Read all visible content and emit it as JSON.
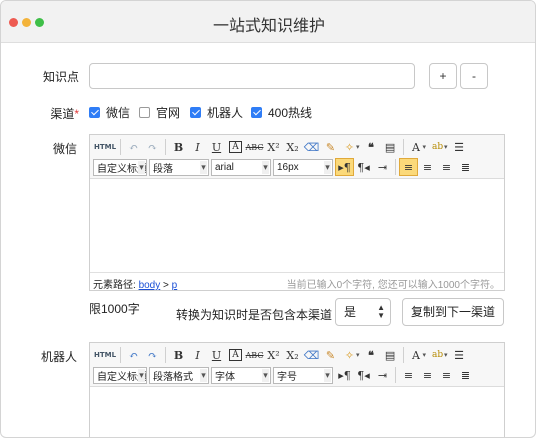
{
  "window": {
    "title": "一站式知识维护"
  },
  "form": {
    "knowledge_label": "知识点",
    "knowledge_value": "",
    "add_label": "+",
    "remove_label": "-",
    "channel_label": "渠道",
    "required_mark": "*",
    "channels": [
      {
        "label": "微信",
        "checked": true
      },
      {
        "label": "官网",
        "checked": false
      },
      {
        "label": "机器人",
        "checked": true
      },
      {
        "label": "400热线",
        "checked": true
      }
    ]
  },
  "wechat": {
    "label": "微信",
    "toolbar": {
      "html": "HTML",
      "style_select": "自定义标题",
      "para_select": "段落",
      "font_select": "arial",
      "size_select": "16px"
    },
    "status": {
      "path_label": "元素路径:",
      "path_body": "body",
      "path_sep": ">",
      "path_p": "p",
      "count": "当前已输入0个字符, 您还可以输入1000个字符。"
    },
    "limit": "限1000字",
    "question": "转换为知识时是否包含本渠道",
    "include_value": "是",
    "copy_button": "复制到下一渠道"
  },
  "robot": {
    "label": "机器人",
    "toolbar": {
      "html": "HTML",
      "style_select": "自定义标题",
      "para_select": "段落格式",
      "font_select": "字体",
      "size_select": "字号"
    }
  },
  "icons": {
    "undo": "undo-icon",
    "redo": "redo-icon",
    "bold": "bold-icon",
    "italic": "italic-icon",
    "underline": "underline-icon",
    "border": "font-border-icon",
    "strike": "strikethrough-icon",
    "sup": "superscript-icon",
    "sub": "subscript-icon",
    "eraser": "eraser-icon",
    "brush": "format-brush-icon",
    "auto": "auto-format-icon",
    "quote": "quote-icon",
    "paste": "paste-plain-icon",
    "forecolor": "font-color-icon",
    "backcolor": "highlight-icon",
    "list": "ordered-list-icon"
  },
  "colors": {
    "accent": "#2f7df6",
    "required": "#e23a3a",
    "link": "#1a4fd6"
  }
}
